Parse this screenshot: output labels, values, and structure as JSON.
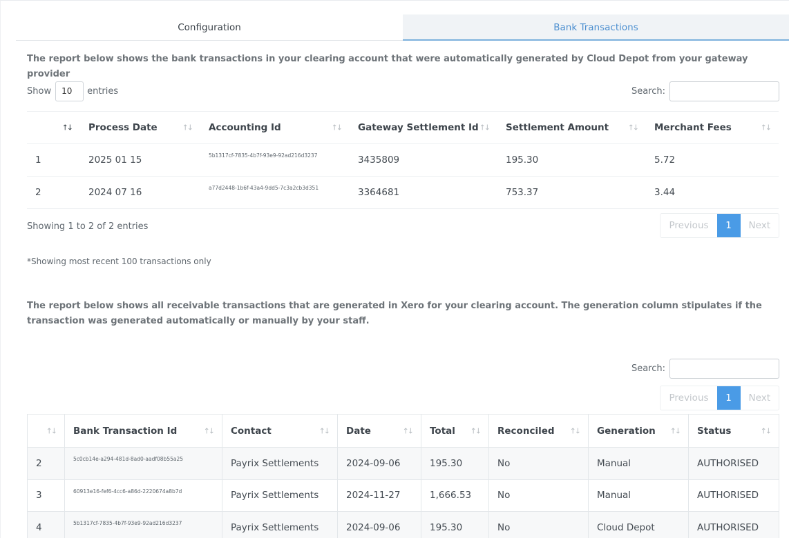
{
  "tabs": {
    "configuration": "Configuration",
    "bank_transactions": "Bank Transactions"
  },
  "accent_color": "#4a9be6",
  "section1": {
    "intro": "The report below shows the bank transactions in your clearing account that were automatically generated by Cloud Depot from your gateway provider",
    "show_label": "Show",
    "entries_value": "10",
    "entries_label": "entries",
    "search_label": "Search:",
    "columns": [
      "",
      "Process Date",
      "Accounting Id",
      "Gateway Settlement Id",
      "Settlement Amount",
      "Merchant Fees"
    ],
    "rows": [
      [
        "1",
        "2025 01 15",
        "5b1317cf-7835-4b7f-93e9-92ad216d3237",
        "3435809",
        "195.30",
        "5.72"
      ],
      [
        "2",
        "2024 07 16",
        "a77d2448-1b6f-43a4-9dd5-7c3a2cb3d351",
        "3364681",
        "753.37",
        "3.44"
      ]
    ],
    "info": "Showing 1 to 2 of 2 entries",
    "previous": "Previous",
    "page": "1",
    "next": "Next",
    "note": "*Showing most recent 100 transactions only"
  },
  "section2": {
    "intro": "The report below shows all receivable transactions that are generated in Xero for your clearing account. The generation column stipulates if the transaction was generated automatically or manually by your staff.",
    "search_label": "Search:",
    "previous": "Previous",
    "page": "1",
    "next": "Next",
    "columns": [
      "",
      "Bank Transaction Id",
      "Contact",
      "Date",
      "Total",
      "Reconciled",
      "Generation",
      "Status"
    ],
    "rows": [
      [
        "2",
        "5c0cb14e-a294-481d-8ad0-aadf08b55a25",
        "Payrix Settlements",
        "2024-09-06",
        "195.30",
        "No",
        "Manual",
        "AUTHORISED"
      ],
      [
        "3",
        "60913e16-fef6-4cc6-a86d-2220674a8b7d",
        "Payrix Settlements",
        "2024-11-27",
        "1,666.53",
        "No",
        "Manual",
        "AUTHORISED"
      ],
      [
        "4",
        "5b1317cf-7835-4b7f-93e9-92ad216d3237",
        "Payrix Settlements",
        "2024-09-06",
        "195.30",
        "No",
        "Cloud Depot",
        "AUTHORISED"
      ]
    ]
  }
}
